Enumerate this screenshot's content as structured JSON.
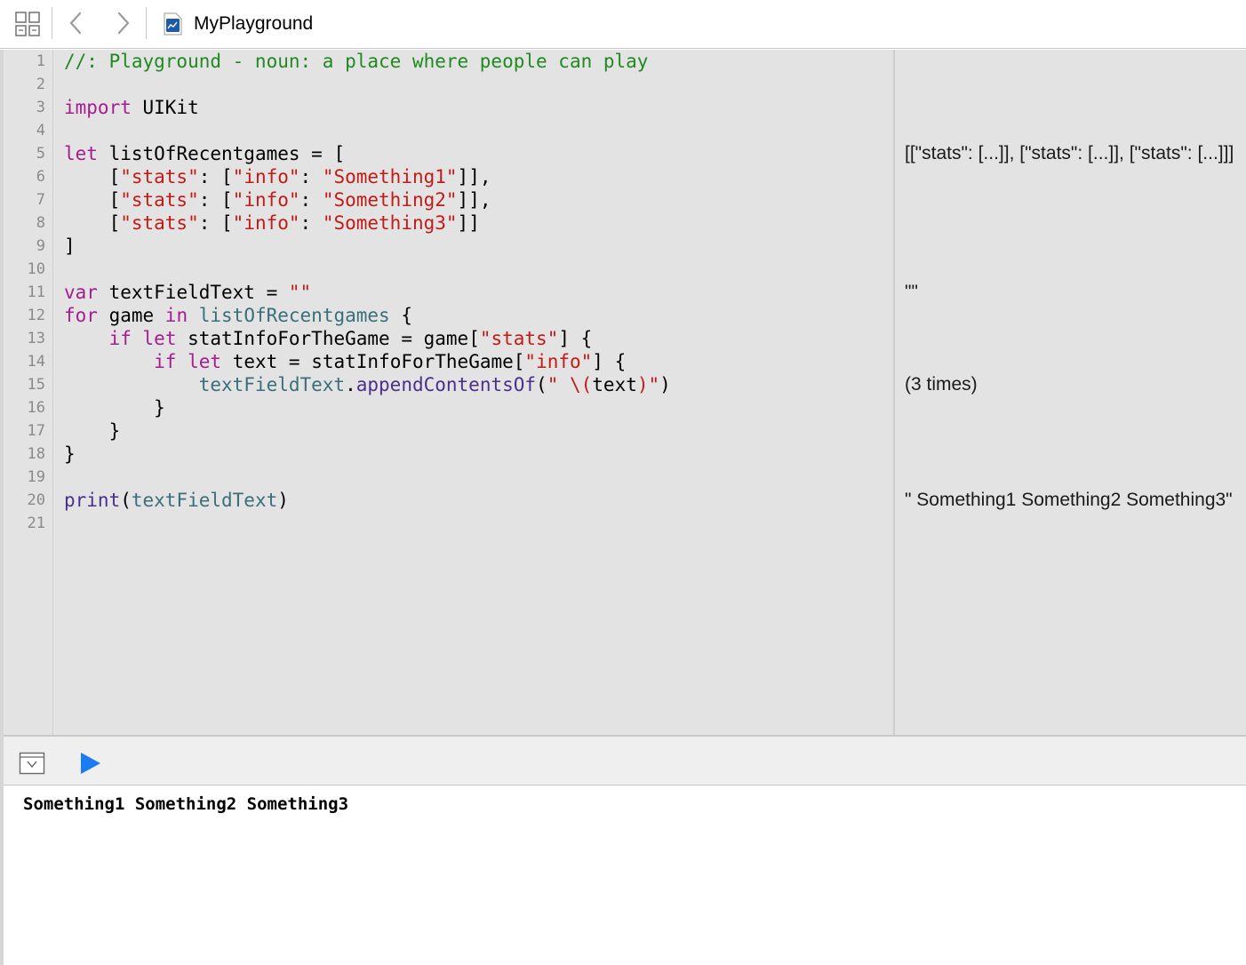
{
  "toolbar": {
    "grid_icon": "related-items-grid-icon",
    "back_icon": "chevron-left-icon",
    "forward_icon": "chevron-right-icon",
    "file_icon": "swift-playground-file-icon",
    "file_title": "MyPlayground"
  },
  "editor": {
    "line_numbers": [
      "1",
      "2",
      "3",
      "4",
      "5",
      "6",
      "7",
      "8",
      "9",
      "10",
      "11",
      "12",
      "13",
      "14",
      "15",
      "16",
      "17",
      "18",
      "19",
      "20",
      "21"
    ],
    "lines": [
      [
        {
          "t": "//: Playground - noun: a place where people can play",
          "c": "c-comment"
        }
      ],
      [],
      [
        {
          "t": "import",
          "c": "c-kw"
        },
        {
          "t": " UIKit",
          "c": ""
        }
      ],
      [],
      [
        {
          "t": "let",
          "c": "c-kw"
        },
        {
          "t": " listOfRecentgames = [",
          "c": ""
        }
      ],
      [
        {
          "t": "    [",
          "c": ""
        },
        {
          "t": "\"stats\"",
          "c": "c-str"
        },
        {
          "t": ": [",
          "c": ""
        },
        {
          "t": "\"info\"",
          "c": "c-str"
        },
        {
          "t": ": ",
          "c": ""
        },
        {
          "t": "\"Something1\"",
          "c": "c-str"
        },
        {
          "t": "]],",
          "c": ""
        }
      ],
      [
        {
          "t": "    [",
          "c": ""
        },
        {
          "t": "\"stats\"",
          "c": "c-str"
        },
        {
          "t": ": [",
          "c": ""
        },
        {
          "t": "\"info\"",
          "c": "c-str"
        },
        {
          "t": ": ",
          "c": ""
        },
        {
          "t": "\"Something2\"",
          "c": "c-str"
        },
        {
          "t": "]],",
          "c": ""
        }
      ],
      [
        {
          "t": "    [",
          "c": ""
        },
        {
          "t": "\"stats\"",
          "c": "c-str"
        },
        {
          "t": ": [",
          "c": ""
        },
        {
          "t": "\"info\"",
          "c": "c-str"
        },
        {
          "t": ": ",
          "c": ""
        },
        {
          "t": "\"Something3\"",
          "c": "c-str"
        },
        {
          "t": "]]",
          "c": ""
        }
      ],
      [
        {
          "t": "]",
          "c": ""
        }
      ],
      [],
      [
        {
          "t": "var",
          "c": "c-kw"
        },
        {
          "t": " textFieldText = ",
          "c": ""
        },
        {
          "t": "\"\"",
          "c": "c-str"
        }
      ],
      [
        {
          "t": "for",
          "c": "c-kw"
        },
        {
          "t": " game ",
          "c": ""
        },
        {
          "t": "in",
          "c": "c-kw"
        },
        {
          "t": " ",
          "c": ""
        },
        {
          "t": "listOfRecentgames",
          "c": "c-id"
        },
        {
          "t": " {",
          "c": ""
        }
      ],
      [
        {
          "t": "    ",
          "c": ""
        },
        {
          "t": "if",
          "c": "c-kw"
        },
        {
          "t": " ",
          "c": ""
        },
        {
          "t": "let",
          "c": "c-kw"
        },
        {
          "t": " statInfoForTheGame = game[",
          "c": ""
        },
        {
          "t": "\"stats\"",
          "c": "c-str"
        },
        {
          "t": "] {",
          "c": ""
        }
      ],
      [
        {
          "t": "        ",
          "c": ""
        },
        {
          "t": "if",
          "c": "c-kw"
        },
        {
          "t": " ",
          "c": ""
        },
        {
          "t": "let",
          "c": "c-kw"
        },
        {
          "t": " text = statInfoForTheGame[",
          "c": ""
        },
        {
          "t": "\"info\"",
          "c": "c-str"
        },
        {
          "t": "] {",
          "c": ""
        }
      ],
      [
        {
          "t": "            ",
          "c": ""
        },
        {
          "t": "textFieldText",
          "c": "c-id"
        },
        {
          "t": ".",
          "c": ""
        },
        {
          "t": "appendContentsOf",
          "c": "c-fn"
        },
        {
          "t": "(",
          "c": ""
        },
        {
          "t": "\" \\(",
          "c": "c-str"
        },
        {
          "t": "text",
          "c": ""
        },
        {
          "t": ")\"",
          "c": "c-str"
        },
        {
          "t": ")",
          "c": ""
        }
      ],
      [
        {
          "t": "        }",
          "c": ""
        }
      ],
      [
        {
          "t": "    }",
          "c": ""
        }
      ],
      [
        {
          "t": "}",
          "c": ""
        }
      ],
      [],
      [
        {
          "t": "print",
          "c": "c-fn"
        },
        {
          "t": "(",
          "c": ""
        },
        {
          "t": "textFieldText",
          "c": "c-id"
        },
        {
          "t": ")",
          "c": ""
        }
      ],
      []
    ]
  },
  "results": [
    {
      "line": 5,
      "text": "[[\"stats\": [...]], [\"stats\": [...]], [\"stats\": [...]]]"
    },
    {
      "line": 11,
      "text": "\"\""
    },
    {
      "line": 15,
      "text": "(3 times)"
    },
    {
      "line": 20,
      "text": "\" Something1 Something2 Something3\""
    }
  ],
  "debugbar": {
    "toggle_icon": "hide-debug-area-icon",
    "run_icon": "play-triangle-icon",
    "run_color": "#1a7cf5"
  },
  "console": {
    "output": "Something1 Something2 Something3"
  }
}
